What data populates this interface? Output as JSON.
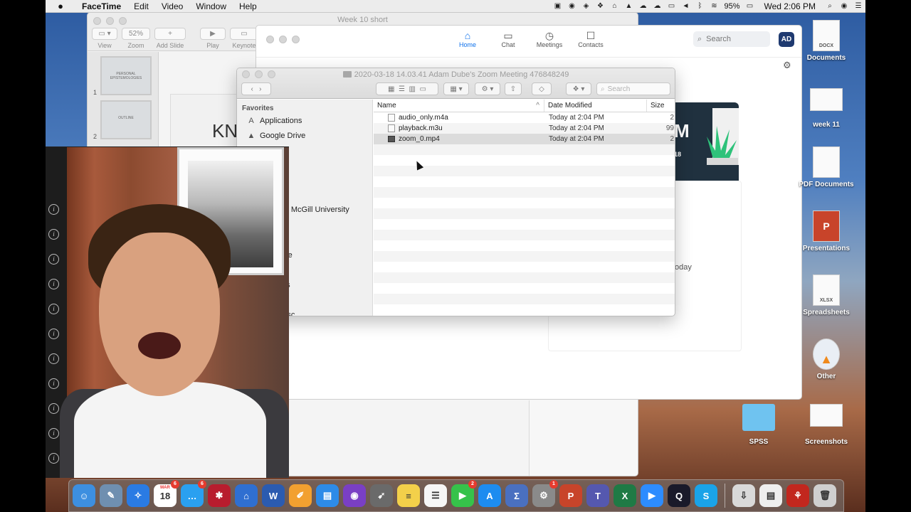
{
  "menubar": {
    "app_name": "FaceTime",
    "menus": [
      "Edit",
      "Video",
      "Window",
      "Help"
    ],
    "battery": "95%",
    "clock": "Wed 2:06 PM"
  },
  "keynote": {
    "title": "Week 10 short",
    "zoom_value": "52%",
    "toolbar": [
      "View",
      "Zoom",
      "Add Slide",
      "Play",
      "Keynote"
    ],
    "slides": [
      {
        "num": "1",
        "caption": "PERSONAL EPISTEMOLOGIES"
      },
      {
        "num": "2",
        "caption": "OUTLINE"
      }
    ],
    "canvas_text": "KN"
  },
  "zoom": {
    "nav": [
      {
        "label": "Home",
        "icon": "⌂"
      },
      {
        "label": "Chat",
        "icon": "▭"
      },
      {
        "label": "Meetings",
        "icon": "◷"
      },
      {
        "label": "Contacts",
        "icon": "☐"
      }
    ],
    "search_placeholder": "Search",
    "avatar": "AD",
    "banner_letter": "M",
    "banner_num": "18",
    "today_label": "today"
  },
  "finder": {
    "title": "2020-03-18 14.03.41 Adam Dube's Zoom Meeting 476848249",
    "search_placeholder": "Search",
    "sidebar_section": "Favorites",
    "favorites": [
      {
        "label": "Applications",
        "icon": "A"
      },
      {
        "label": "Google Drive",
        "icon": "▲"
      },
      {
        "label": "pe",
        "icon": ""
      },
      {
        "label": "ds",
        "icon": ""
      },
      {
        "label": "e - McGill University",
        "icon": ""
      },
      {
        "label": "rive",
        "icon": ""
      },
      {
        "label": "nts",
        "icon": ""
      },
      {
        "label": "Disc",
        "icon": ""
      }
    ],
    "columns": {
      "name": "Name",
      "date": "Date Modified",
      "size": "Size"
    },
    "files": [
      {
        "name": "audio_only.m4a",
        "date": "Today at 2:04 PM",
        "size": "2"
      },
      {
        "name": "playback.m3u",
        "date": "Today at 2:04 PM",
        "size": "99"
      },
      {
        "name": "zoom_0.mp4",
        "date": "Today at 2:04 PM",
        "size": "2"
      }
    ]
  },
  "desktop": {
    "icons": [
      {
        "label": "Documents",
        "thumb": "DOCX"
      },
      {
        "label": "week 11",
        "thumb": ""
      },
      {
        "label": "PDF Documents",
        "thumb": ""
      },
      {
        "label": "Presentations",
        "thumb": "P"
      },
      {
        "label": "Spreadsheets",
        "thumb": "XLSX"
      },
      {
        "label": "Other",
        "thumb": ""
      },
      {
        "label": "SPSS",
        "thumb": ""
      },
      {
        "label": "Screenshots",
        "thumb": ""
      }
    ]
  },
  "dock": {
    "apps": [
      {
        "name": "Finder",
        "glyph": "☺",
        "color": "#3d8fe0"
      },
      {
        "name": "Preview",
        "glyph": "✎",
        "color": "#6f8fb0"
      },
      {
        "name": "Safari",
        "glyph": "✧",
        "color": "#2a7be4"
      },
      {
        "name": "Calendar",
        "glyph": "18",
        "color": "#ffffff",
        "badge": "6",
        "label": "MAR"
      },
      {
        "name": "Messages",
        "glyph": "…",
        "color": "#2aa0f0",
        "badge": "6"
      },
      {
        "name": "Mendeley",
        "glyph": "✱",
        "color": "#b81c2e"
      },
      {
        "name": "Library",
        "glyph": "⌂",
        "color": "#2f6fd1"
      },
      {
        "name": "Word",
        "glyph": "W",
        "color": "#2b5bb0"
      },
      {
        "name": "Pages",
        "glyph": "✐",
        "color": "#f2a030"
      },
      {
        "name": "Keynote",
        "glyph": "▤",
        "color": "#2d8be8"
      },
      {
        "name": "Siri",
        "glyph": "◉",
        "color": "#7a3fc4"
      },
      {
        "name": "Launchpad",
        "glyph": "➹",
        "color": "#6a6a6a"
      },
      {
        "name": "Notes",
        "glyph": "≡",
        "color": "#f3d04a"
      },
      {
        "name": "Reminders",
        "glyph": "☰",
        "color": "#f6f6f6"
      },
      {
        "name": "FaceTime",
        "glyph": "▶",
        "color": "#36c24a",
        "badge": "2"
      },
      {
        "name": "App Store",
        "glyph": "A",
        "color": "#1d8cf0"
      },
      {
        "name": "Equation",
        "glyph": "Σ",
        "color": "#4a70c0"
      },
      {
        "name": "System Preferences",
        "glyph": "⚙",
        "color": "#8a8a8a",
        "badge": "1"
      },
      {
        "name": "PowerPoint",
        "glyph": "P",
        "color": "#c8442a"
      },
      {
        "name": "Teams",
        "glyph": "T",
        "color": "#5558af"
      },
      {
        "name": "Excel",
        "glyph": "X",
        "color": "#1f7a45"
      },
      {
        "name": "Zoom",
        "glyph": "▶",
        "color": "#2d8cff"
      },
      {
        "name": "QuickTime",
        "glyph": "Q",
        "color": "#1a1a2a"
      },
      {
        "name": "Skype",
        "glyph": "S",
        "color": "#1aa3e8"
      }
    ],
    "stacks": [
      {
        "name": "Downloads",
        "glyph": "⇩",
        "color": "#d9d9d9"
      },
      {
        "name": "Documents",
        "glyph": "▤",
        "color": "#eeeeee"
      },
      {
        "name": "Acrobat",
        "glyph": "⚘",
        "color": "#c2271e"
      },
      {
        "name": "Trash",
        "glyph": "🗑",
        "color": "#cfcfcf"
      }
    ]
  }
}
